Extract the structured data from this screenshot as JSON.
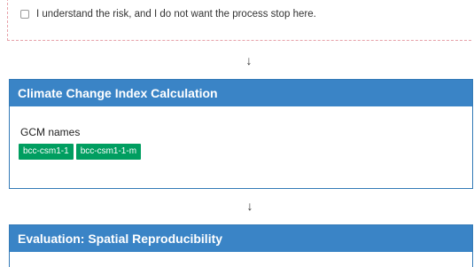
{
  "risk": {
    "checkbox_label": "I understand the risk, and I do not want the process stop here."
  },
  "arrows": {
    "glyph": "↓"
  },
  "climate_panel": {
    "title": "Climate Change Index Calculation",
    "field_label": "GCM names",
    "tags": [
      "bcc-csm1-1",
      "bcc-csm1-1-m"
    ]
  },
  "evaluation_panel": {
    "title": "Evaluation: Spatial Reproducibility"
  },
  "colors": {
    "panel_header": "#3a84c6",
    "tag_green": "#009e60",
    "dashed_border": "#e7a1a8"
  }
}
